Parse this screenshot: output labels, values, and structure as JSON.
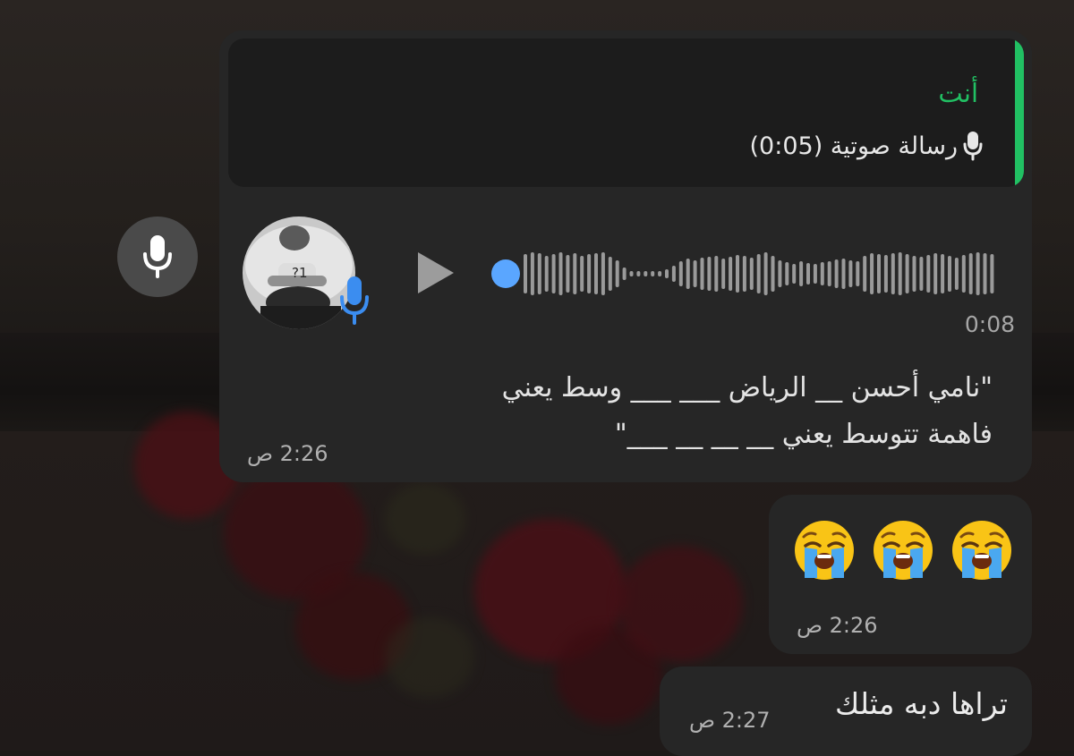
{
  "chat": {
    "messages": [
      {
        "type": "voice",
        "reply": {
          "author": "أنت",
          "label": "رسالة صوتية (0:05)",
          "icon": "mic-icon"
        },
        "play_icon": "play-icon",
        "duration": "0:08",
        "transcript_lines": [
          "\"نامي أحسن __ الرياض ___ ___ وسط يعني",
          "فاهمة تتوسط يعني __ __ __ ___\""
        ],
        "time": "2:26 ص"
      },
      {
        "type": "text",
        "text": "😭😭😭",
        "time": "2:26 ص"
      },
      {
        "type": "text",
        "text": "تراها دبه مثلك",
        "time": "2:27 ص"
      }
    ],
    "record_button_icon": "mic-icon",
    "colors": {
      "accent": "#21c063",
      "voice_mic": "#3b8df0",
      "progress_dot": "#5aa6ff",
      "bubble": "#262626",
      "quote_bg": "#1c1c1c"
    }
  }
}
